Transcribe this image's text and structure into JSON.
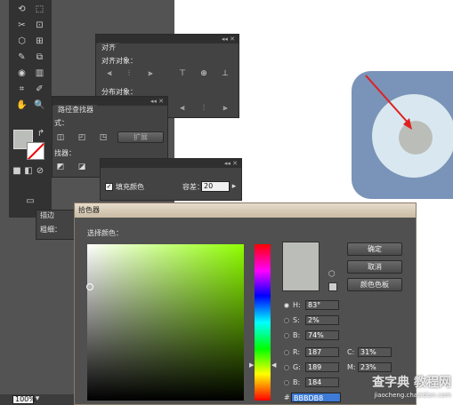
{
  "toolbar": {
    "tools": [
      "⟲",
      "⬚",
      "✂",
      "⊡",
      "⬡",
      "⊞",
      "✎",
      "⧉",
      "◉",
      "▥",
      "⌗",
      "✐",
      "✋",
      "🔍"
    ],
    "fill_color": "#bbbdb8",
    "swap_icon": "↱",
    "mode_icons": [
      "■",
      "◧",
      "⊘"
    ],
    "screen_icon": "▭"
  },
  "align_panel": {
    "title": "对齐",
    "align_objects_label": "对齐对象：",
    "distribute_label": "分布对象："
  },
  "pathfinder_panel": {
    "title": "路径查找器",
    "shape_modes_label": "式：",
    "expand_button": "扩展",
    "pathfinders_label": "找器："
  },
  "magic_wand_panel": {
    "fill_color_label": "填充颜色",
    "tolerance_label": "容差：",
    "tolerance_value": "20"
  },
  "stroke_panel": {
    "tab_label": "描边",
    "weight_label": "粗细："
  },
  "status_bar": {
    "zoom": "100%"
  },
  "color_picker": {
    "title": "拾色器",
    "select_color_label": "选择颜色：",
    "ok_button": "确定",
    "cancel_button": "取消",
    "swatches_button": "颜色色板",
    "current_color": "#bbbdb8",
    "fields": [
      {
        "label": "H:",
        "value": "83°"
      },
      {
        "label": "S:",
        "value": "2%"
      },
      {
        "label": "B:",
        "value": "74%"
      },
      {
        "label": "R:",
        "value": "187"
      },
      {
        "label": "G:",
        "value": "189"
      },
      {
        "label": "B:",
        "value": "184"
      }
    ],
    "cmyk_fields": [
      {
        "label": "C:",
        "value": "31%"
      },
      {
        "label": "M:",
        "value": "23%"
      }
    ],
    "hex_label": "#",
    "hex_value": "BBBDB8"
  },
  "preview": {
    "bg_color": "#7a93b8",
    "ring_color": "#d9e8f0",
    "center_color": "#bbbdb8",
    "arrow_color": "#e02020"
  },
  "watermark": {
    "line1": "查字典 教程网",
    "line2": "jiaocheng.chazidian.com"
  }
}
